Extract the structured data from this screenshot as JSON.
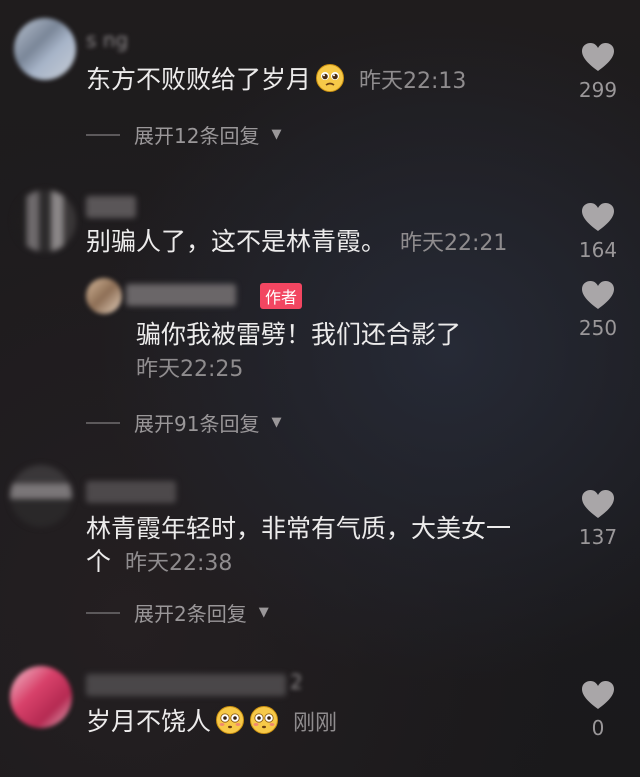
{
  "comments": [
    {
      "username": "s     ng",
      "text": "东方不败败给了岁月",
      "time": "昨天22:13",
      "likes": "299",
      "expand": "展开12条回复"
    },
    {
      "text": "别骗人了，这不是林青霞。",
      "time": "昨天22:21",
      "likes": "164",
      "reply": {
        "author_tag": "作者",
        "text": "骗你我被雷劈！我们还合影了",
        "time": "昨天22:25",
        "likes": "250"
      },
      "expand": "展开91条回复"
    },
    {
      "text_line1": "林青霞年轻时，非常有气质，大美女一",
      "text_line2": "个",
      "time": "昨天22:38",
      "likes": "137",
      "expand": "展开2条回复"
    },
    {
      "username_suffix": "2",
      "text": "岁月不饶人",
      "time": "刚刚",
      "likes": "0"
    }
  ],
  "icons": {
    "like": "heart-icon",
    "expand_caret": "caret-down-icon",
    "emoji_pleading": "pleading-face-emoji",
    "emoji_flushed": "flushed-face-emoji"
  },
  "colors": {
    "author_tag": "#f24661",
    "text": "#ecebeb",
    "muted": "#8f8c8e"
  }
}
